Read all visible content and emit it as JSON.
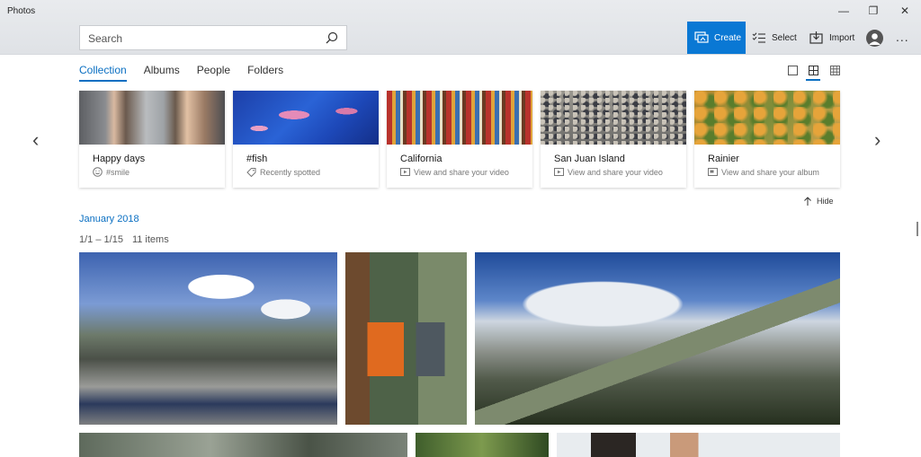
{
  "window": {
    "title": "Photos",
    "minimize": "—",
    "maximize": "❐",
    "close": "✕"
  },
  "search": {
    "placeholder": "Search",
    "icon": "search-icon"
  },
  "toolbar": {
    "create_label": "Create",
    "select_label": "Select",
    "import_label": "Import",
    "more_label": "..."
  },
  "accent_color": "#0a78d4",
  "tabs": [
    {
      "label": "Collection",
      "active": true
    },
    {
      "label": "Albums",
      "active": false
    },
    {
      "label": "People",
      "active": false
    },
    {
      "label": "Folders",
      "active": false
    }
  ],
  "view_modes": [
    "single-view-icon",
    "medium-grid-icon",
    "small-grid-icon"
  ],
  "carousel": {
    "prev": "‹",
    "next": "›",
    "cards": [
      {
        "title": "Happy days",
        "subtitle": "#smile",
        "icon": "smile-icon"
      },
      {
        "title": "#fish",
        "subtitle": "Recently spotted",
        "icon": "tag-icon"
      },
      {
        "title": "California",
        "subtitle": "View and share your video",
        "icon": "video-icon"
      },
      {
        "title": "San Juan Island",
        "subtitle": "View and share your video",
        "icon": "video-icon"
      },
      {
        "title": "Rainier",
        "subtitle": "View and share your album",
        "icon": "album-icon"
      }
    ],
    "hide_label": "Hide"
  },
  "collection": {
    "month": "January 2018",
    "date_range": "1/1 – 1/15",
    "item_count": "11 items"
  }
}
